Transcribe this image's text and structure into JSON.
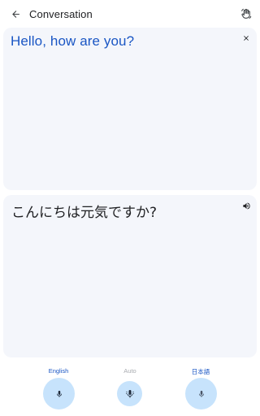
{
  "header": {
    "title": "Conversation"
  },
  "source": {
    "text": "Hello, how are you?",
    "language": "English"
  },
  "translation": {
    "text": "こんにちは元気ですか?",
    "language": "日本語"
  },
  "bottom_bar": {
    "left_label": "English",
    "center_label": "Auto",
    "right_label": "日本語"
  },
  "icons": {
    "back": "arrow-back-icon",
    "header_action": "hand-wave-icon",
    "close": "close-icon",
    "speaker": "speaker-icon",
    "mic": "mic-icon",
    "auto_mic": "auto-mic-icon"
  },
  "colors": {
    "accent": "#1a56c4",
    "card_bg": "#f4f6fb",
    "mic_bg": "#c7e3fc",
    "muted": "#a8abb0"
  }
}
